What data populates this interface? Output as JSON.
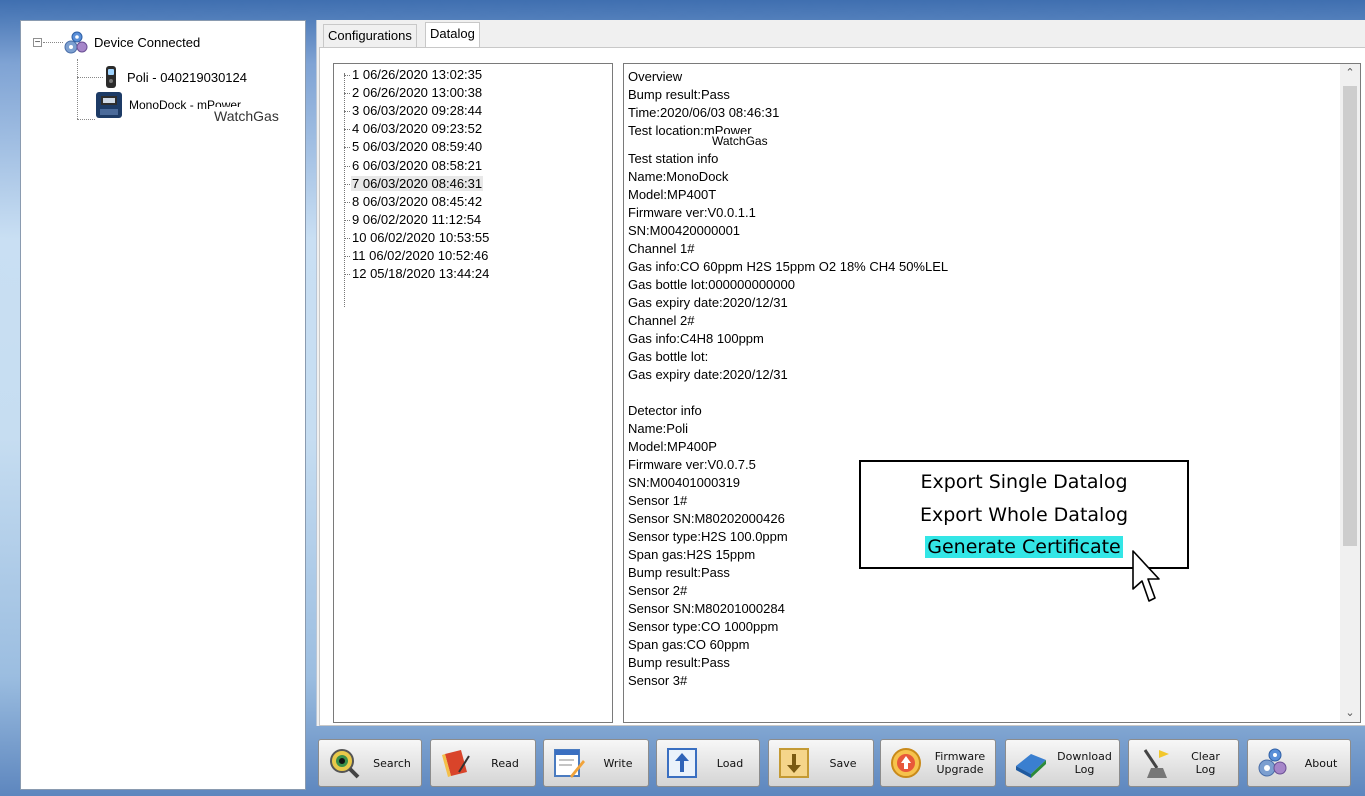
{
  "tree": {
    "root_label": "Device Connected",
    "expander": "−",
    "children": [
      {
        "label": "Poli - 040219030124",
        "icon": "detector-icon"
      },
      {
        "label": "MonoDock - mPower",
        "icon": "dock-icon"
      }
    ],
    "watermark": "WatchGas"
  },
  "tabs": [
    {
      "label": "Configurations",
      "active": false
    },
    {
      "label": "Datalog",
      "active": true
    }
  ],
  "datalog_list": [
    "1 06/26/2020 13:02:35",
    "2 06/26/2020 13:00:38",
    "3 06/03/2020 09:28:44",
    "4 06/03/2020 09:23:52",
    "5 06/03/2020 08:59:40",
    "6 06/03/2020 08:58:21",
    "7 06/03/2020 08:46:31",
    "8 06/03/2020 08:45:42",
    "9 06/02/2020 11:12:54",
    "10 06/02/2020 10:53:55",
    "11 06/02/2020 10:52:46",
    "12 05/18/2020 13:44:24"
  ],
  "selected_index": 6,
  "detail": {
    "overview": [
      "Overview",
      "Bump result:Pass",
      "Time:2020/06/03 08:46:31",
      "Test location:mPower"
    ],
    "watermark": "WatchGas",
    "station": [
      "Test station info",
      "Name:MonoDock",
      "Model:MP400T",
      "Firmware ver:V0.0.1.1",
      "SN:M00420000001",
      "Channel 1#",
      "Gas info:CO 60ppm H2S 15ppm O2 18% CH4 50%LEL",
      "Gas bottle lot:000000000000",
      "Gas expiry date:2020/12/31",
      "Channel 2#",
      "Gas info:C4H8 100ppm",
      "Gas bottle lot:",
      "Gas expiry date:2020/12/31"
    ],
    "detector": [
      "Detector info",
      "Name:Poli",
      "Model:MP400P",
      "Firmware ver:V0.0.7.5",
      "SN:M00401000319",
      "Sensor 1#",
      "Sensor SN:M80202000426",
      "Sensor type:H2S 100.0ppm",
      "Span gas:H2S 15ppm",
      "Bump result:Pass",
      "Sensor 2#",
      "Sensor SN:M80201000284",
      "Sensor type:CO 1000ppm",
      "Span gas:CO 60ppm",
      "Bump result:Pass",
      "Sensor 3#"
    ]
  },
  "context_menu": {
    "items": [
      "Export Single Datalog",
      "Export Whole Datalog",
      "Generate Certificate"
    ],
    "highlight_color": "#33e6e6"
  },
  "toolbar": [
    {
      "label": "Search",
      "icon": "search-icon"
    },
    {
      "label": "Read",
      "icon": "read-icon"
    },
    {
      "label": "Write",
      "icon": "write-icon"
    },
    {
      "label": "Load",
      "icon": "load-icon"
    },
    {
      "label": "Save",
      "icon": "save-icon"
    },
    {
      "label": "Firmware Upgrade",
      "icon": "upgrade-icon"
    },
    {
      "label": "Download Log",
      "icon": "download-icon"
    },
    {
      "label": "Clear Log",
      "icon": "broom-icon"
    },
    {
      "label": "About",
      "icon": "gears-icon"
    }
  ]
}
